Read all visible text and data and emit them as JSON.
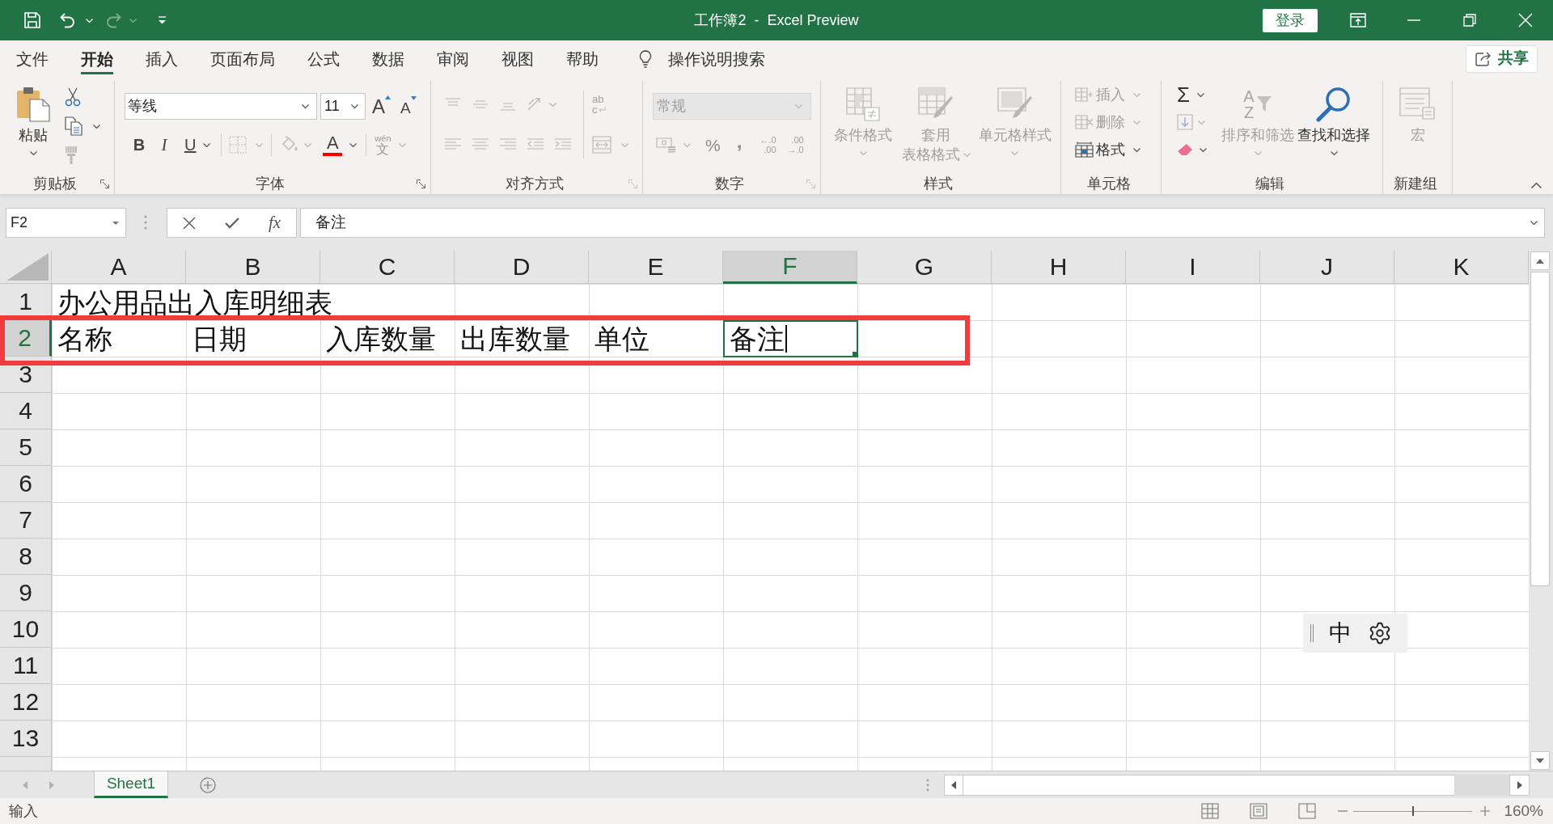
{
  "title_bar": {
    "quick_access": [
      {
        "kind": "save",
        "disabled": false
      },
      {
        "kind": "undo",
        "disabled": false
      },
      {
        "kind": "redo",
        "disabled": true
      },
      {
        "kind": "customize",
        "disabled": false
      }
    ],
    "title": "工作簿2  -  Excel Preview",
    "sign_in": "登录"
  },
  "ribbon_tabs": [
    {
      "label": "文件",
      "selected": false
    },
    {
      "label": "开始",
      "selected": true
    },
    {
      "label": "插入",
      "selected": false
    },
    {
      "label": "页面布局",
      "selected": false
    },
    {
      "label": "公式",
      "selected": false
    },
    {
      "label": "数据",
      "selected": false
    },
    {
      "label": "审阅",
      "selected": false
    },
    {
      "label": "视图",
      "selected": false
    },
    {
      "label": "帮助",
      "selected": false
    }
  ],
  "tell_me": "操作说明搜索",
  "share": "共享",
  "ribbon": {
    "clipboard": {
      "label": "剪贴板",
      "paste": "粘贴",
      "tools": [
        {
          "kind": "cut",
          "disabled": false
        },
        {
          "kind": "copy",
          "disabled": false
        },
        {
          "kind": "format_painter",
          "disabled": true
        }
      ]
    },
    "font": {
      "label": "字体",
      "font_name": "等线",
      "font_size": "11",
      "grow_font": "A",
      "shrink_font": "A",
      "bold": "B",
      "italic": "I",
      "underline": "U",
      "borders_disabled": true,
      "fill_disabled": true,
      "font_color": "A",
      "phonetic": [
        "wén",
        "文"
      ],
      "phonetic_disabled": true
    },
    "alignment": {
      "label": "对齐方式",
      "disabled": true,
      "wrap_text": [
        "ab",
        "c"
      ]
    },
    "number": {
      "label": "数字",
      "disabled": true,
      "format": "常规",
      "percent": "%",
      "comma": ",",
      "increase_decimal": [
        "←.0",
        ".00"
      ],
      "decrease_decimal": [
        ".00",
        "→.0"
      ]
    },
    "styles": {
      "label": "样式",
      "buttons": [
        {
          "kind": "conditional_format",
          "lines": [
            "条件格式"
          ],
          "disabled": true
        },
        {
          "kind": "table_format",
          "lines": [
            "套用",
            "表格格式"
          ],
          "disabled": true
        },
        {
          "kind": "cell_styles",
          "lines": [
            "单元格样式"
          ],
          "disabled": true
        }
      ]
    },
    "cells": {
      "label": "单元格",
      "buttons": [
        {
          "kind": "insert",
          "label": "插入",
          "disabled": true
        },
        {
          "kind": "delete",
          "label": "删除",
          "disabled": true
        },
        {
          "kind": "format",
          "label": "格式",
          "disabled": false
        }
      ]
    },
    "editing": {
      "label": "编辑",
      "sum": {
        "glyph": "Σ",
        "disabled": false
      },
      "fill_disabled": true,
      "clear_disabled": false,
      "sort_filter": {
        "letters": [
          "A",
          "Z"
        ],
        "label": "排序和筛选",
        "disabled": true
      },
      "find_select": {
        "label": "查找和选择",
        "disabled": false
      }
    },
    "new_group": {
      "label": "新建组",
      "macro": {
        "label": "宏",
        "disabled": true
      }
    }
  },
  "formula_bar": {
    "name_box": "F2",
    "fx": "fx",
    "formula": "备注"
  },
  "grid": {
    "columns": [
      {
        "label": "A",
        "selected": false
      },
      {
        "label": "B",
        "selected": false
      },
      {
        "label": "C",
        "selected": false
      },
      {
        "label": "D",
        "selected": false
      },
      {
        "label": "E",
        "selected": false
      },
      {
        "label": "F",
        "selected": true
      },
      {
        "label": "G",
        "selected": false
      },
      {
        "label": "H",
        "selected": false
      },
      {
        "label": "I",
        "selected": false
      },
      {
        "label": "J",
        "selected": false
      },
      {
        "label": "K",
        "selected": false
      }
    ],
    "rows": [
      {
        "label": "1",
        "selected": false,
        "cells": [
          {
            "text": "办公用品出入库明细表",
            "selected": false
          }
        ]
      },
      {
        "label": "2",
        "selected": true,
        "cells": [
          {
            "text": "名称",
            "selected": false
          },
          {
            "text": "日期",
            "selected": false
          },
          {
            "text": "入库数量",
            "selected": false
          },
          {
            "text": "出库数量",
            "selected": false
          },
          {
            "text": "单位",
            "selected": false
          },
          {
            "text": "备注",
            "selected": true
          }
        ]
      },
      {
        "label": "3",
        "selected": false
      },
      {
        "label": "4",
        "selected": false
      },
      {
        "label": "5",
        "selected": false
      },
      {
        "label": "6",
        "selected": false
      },
      {
        "label": "7",
        "selected": false
      },
      {
        "label": "8",
        "selected": false
      },
      {
        "label": "9",
        "selected": false
      },
      {
        "label": "10",
        "selected": false
      },
      {
        "label": "11",
        "selected": false
      },
      {
        "label": "12",
        "selected": false
      },
      {
        "label": "13",
        "selected": false
      }
    ]
  },
  "sheet_tabs": [
    {
      "label": "Sheet1",
      "selected": true
    }
  ],
  "status_bar": {
    "mode": "输入",
    "views": [
      {
        "kind": "normal"
      },
      {
        "kind": "page_layout"
      },
      {
        "kind": "page_break"
      }
    ],
    "zoom": {
      "level": 0.5,
      "reading": "160%"
    }
  },
  "ime_toolbar": {
    "mode": "中"
  }
}
